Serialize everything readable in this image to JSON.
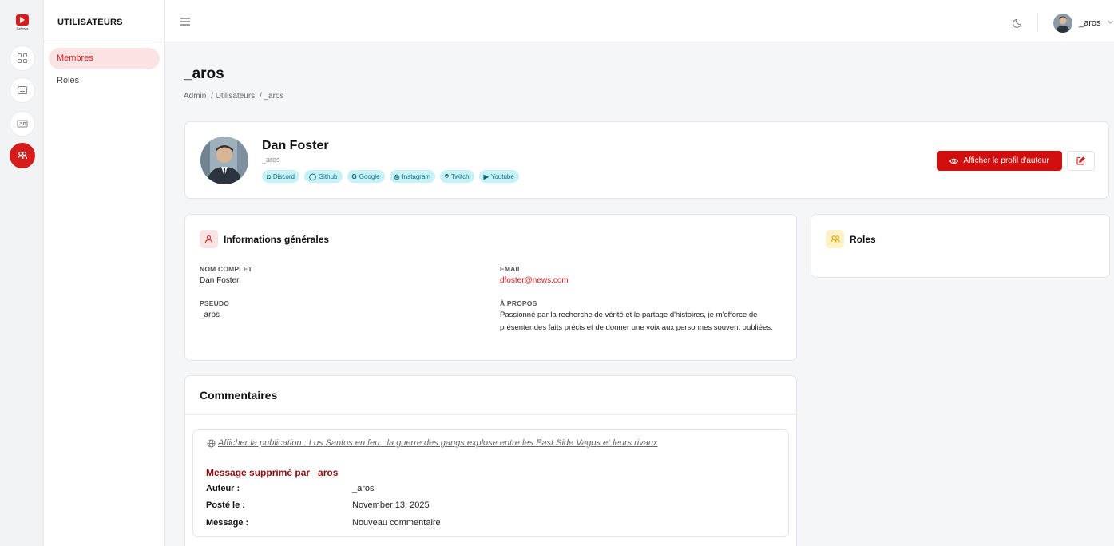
{
  "brand": {
    "logo_text": "SaNews"
  },
  "sidebar": {
    "section_title": "UTILISATEURS",
    "items": [
      {
        "label": "Membres",
        "active": true
      },
      {
        "label": "Roles",
        "active": false
      }
    ]
  },
  "topbar": {
    "user_name": "_aros"
  },
  "page": {
    "title": "_aros",
    "breadcrumb": [
      "Admin",
      "/ Utilisateurs",
      "/ _aros"
    ]
  },
  "profile": {
    "name": "Dan Foster",
    "handle": "_aros",
    "socials": [
      {
        "label": "Discord",
        "icon": "discord-icon",
        "glyph": "◘"
      },
      {
        "label": "Github",
        "icon": "github-icon",
        "glyph": "◯"
      },
      {
        "label": "Google",
        "icon": "google-icon",
        "glyph": "G"
      },
      {
        "label": "Instagram",
        "icon": "instagram-icon",
        "glyph": "◎"
      },
      {
        "label": "Twitch",
        "icon": "twitch-icon",
        "glyph": "⍟"
      },
      {
        "label": "Youtube",
        "icon": "youtube-icon",
        "glyph": "▶"
      }
    ],
    "author_button": "Afficher le profil d'auteur"
  },
  "info": {
    "title": "Informations générales",
    "fullname_label": "NOM COMPLET",
    "fullname": "Dan Foster",
    "email_label": "EMAIL",
    "email": "dfoster@news.com",
    "pseudo_label": "PSEUDO",
    "pseudo": "_aros",
    "about_label": "À PROPOS",
    "about": "Passionné par la recherche de vérité et le partage d'histoires, je m'efforce de présenter des faits précis et de donner une voix aux personnes souvent oubliées."
  },
  "roles": {
    "title": "Roles"
  },
  "comments": {
    "title": "Commentaires",
    "items": [
      {
        "publication_link": "Afficher la publication : Los Santos en feu : la guerre des gangs explose entre les East Side Vagos et leurs rivaux",
        "deleted_notice": "Message supprimé par _aros",
        "author_label": "Auteur :",
        "author": "_aros",
        "posted_label": "Posté le :",
        "posted": "November 13, 2025",
        "message_label": "Message :",
        "message": "Nouveau commentaire"
      }
    ]
  },
  "colors": {
    "accent": "#d61b1b",
    "chip_bg": "#c6f1f6",
    "deleted_text": "#8b0d0d"
  }
}
